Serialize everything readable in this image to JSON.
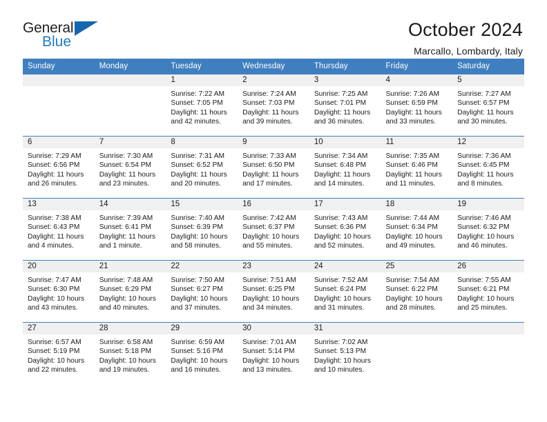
{
  "brand": {
    "name_top": "General",
    "name_bottom": "Blue",
    "triangle_color": "#1566ae",
    "blue_color": "#1f7ac4"
  },
  "header": {
    "title": "October 2024",
    "subtitle": "Marcallo, Lombardy, Italy"
  },
  "theme": {
    "header_bg": "#3f7fbf",
    "daynum_bg": "#f0f0f0",
    "text": "#1a1a1a"
  },
  "weekdays": [
    "Sunday",
    "Monday",
    "Tuesday",
    "Wednesday",
    "Thursday",
    "Friday",
    "Saturday"
  ],
  "labels": {
    "sunrise_prefix": "Sunrise:",
    "sunset_prefix": "Sunset:",
    "daylight_prefix": "Daylight:"
  },
  "weeks": [
    [
      {
        "blank": true
      },
      {
        "blank": true
      },
      {
        "day": "1",
        "sunrise": "Sunrise: 7:22 AM",
        "sunset": "Sunset: 7:05 PM",
        "daylight_line1": "Daylight: 11 hours",
        "daylight_line2": "and 42 minutes."
      },
      {
        "day": "2",
        "sunrise": "Sunrise: 7:24 AM",
        "sunset": "Sunset: 7:03 PM",
        "daylight_line1": "Daylight: 11 hours",
        "daylight_line2": "and 39 minutes."
      },
      {
        "day": "3",
        "sunrise": "Sunrise: 7:25 AM",
        "sunset": "Sunset: 7:01 PM",
        "daylight_line1": "Daylight: 11 hours",
        "daylight_line2": "and 36 minutes."
      },
      {
        "day": "4",
        "sunrise": "Sunrise: 7:26 AM",
        "sunset": "Sunset: 6:59 PM",
        "daylight_line1": "Daylight: 11 hours",
        "daylight_line2": "and 33 minutes."
      },
      {
        "day": "5",
        "sunrise": "Sunrise: 7:27 AM",
        "sunset": "Sunset: 6:57 PM",
        "daylight_line1": "Daylight: 11 hours",
        "daylight_line2": "and 30 minutes."
      }
    ],
    [
      {
        "day": "6",
        "sunrise": "Sunrise: 7:29 AM",
        "sunset": "Sunset: 6:56 PM",
        "daylight_line1": "Daylight: 11 hours",
        "daylight_line2": "and 26 minutes."
      },
      {
        "day": "7",
        "sunrise": "Sunrise: 7:30 AM",
        "sunset": "Sunset: 6:54 PM",
        "daylight_line1": "Daylight: 11 hours",
        "daylight_line2": "and 23 minutes."
      },
      {
        "day": "8",
        "sunrise": "Sunrise: 7:31 AM",
        "sunset": "Sunset: 6:52 PM",
        "daylight_line1": "Daylight: 11 hours",
        "daylight_line2": "and 20 minutes."
      },
      {
        "day": "9",
        "sunrise": "Sunrise: 7:33 AM",
        "sunset": "Sunset: 6:50 PM",
        "daylight_line1": "Daylight: 11 hours",
        "daylight_line2": "and 17 minutes."
      },
      {
        "day": "10",
        "sunrise": "Sunrise: 7:34 AM",
        "sunset": "Sunset: 6:48 PM",
        "daylight_line1": "Daylight: 11 hours",
        "daylight_line2": "and 14 minutes."
      },
      {
        "day": "11",
        "sunrise": "Sunrise: 7:35 AM",
        "sunset": "Sunset: 6:46 PM",
        "daylight_line1": "Daylight: 11 hours",
        "daylight_line2": "and 11 minutes."
      },
      {
        "day": "12",
        "sunrise": "Sunrise: 7:36 AM",
        "sunset": "Sunset: 6:45 PM",
        "daylight_line1": "Daylight: 11 hours",
        "daylight_line2": "and 8 minutes."
      }
    ],
    [
      {
        "day": "13",
        "sunrise": "Sunrise: 7:38 AM",
        "sunset": "Sunset: 6:43 PM",
        "daylight_line1": "Daylight: 11 hours",
        "daylight_line2": "and 4 minutes."
      },
      {
        "day": "14",
        "sunrise": "Sunrise: 7:39 AM",
        "sunset": "Sunset: 6:41 PM",
        "daylight_line1": "Daylight: 11 hours",
        "daylight_line2": "and 1 minute."
      },
      {
        "day": "15",
        "sunrise": "Sunrise: 7:40 AM",
        "sunset": "Sunset: 6:39 PM",
        "daylight_line1": "Daylight: 10 hours",
        "daylight_line2": "and 58 minutes."
      },
      {
        "day": "16",
        "sunrise": "Sunrise: 7:42 AM",
        "sunset": "Sunset: 6:37 PM",
        "daylight_line1": "Daylight: 10 hours",
        "daylight_line2": "and 55 minutes."
      },
      {
        "day": "17",
        "sunrise": "Sunrise: 7:43 AM",
        "sunset": "Sunset: 6:36 PM",
        "daylight_line1": "Daylight: 10 hours",
        "daylight_line2": "and 52 minutes."
      },
      {
        "day": "18",
        "sunrise": "Sunrise: 7:44 AM",
        "sunset": "Sunset: 6:34 PM",
        "daylight_line1": "Daylight: 10 hours",
        "daylight_line2": "and 49 minutes."
      },
      {
        "day": "19",
        "sunrise": "Sunrise: 7:46 AM",
        "sunset": "Sunset: 6:32 PM",
        "daylight_line1": "Daylight: 10 hours",
        "daylight_line2": "and 46 minutes."
      }
    ],
    [
      {
        "day": "20",
        "sunrise": "Sunrise: 7:47 AM",
        "sunset": "Sunset: 6:30 PM",
        "daylight_line1": "Daylight: 10 hours",
        "daylight_line2": "and 43 minutes."
      },
      {
        "day": "21",
        "sunrise": "Sunrise: 7:48 AM",
        "sunset": "Sunset: 6:29 PM",
        "daylight_line1": "Daylight: 10 hours",
        "daylight_line2": "and 40 minutes."
      },
      {
        "day": "22",
        "sunrise": "Sunrise: 7:50 AM",
        "sunset": "Sunset: 6:27 PM",
        "daylight_line1": "Daylight: 10 hours",
        "daylight_line2": "and 37 minutes."
      },
      {
        "day": "23",
        "sunrise": "Sunrise: 7:51 AM",
        "sunset": "Sunset: 6:25 PM",
        "daylight_line1": "Daylight: 10 hours",
        "daylight_line2": "and 34 minutes."
      },
      {
        "day": "24",
        "sunrise": "Sunrise: 7:52 AM",
        "sunset": "Sunset: 6:24 PM",
        "daylight_line1": "Daylight: 10 hours",
        "daylight_line2": "and 31 minutes."
      },
      {
        "day": "25",
        "sunrise": "Sunrise: 7:54 AM",
        "sunset": "Sunset: 6:22 PM",
        "daylight_line1": "Daylight: 10 hours",
        "daylight_line2": "and 28 minutes."
      },
      {
        "day": "26",
        "sunrise": "Sunrise: 7:55 AM",
        "sunset": "Sunset: 6:21 PM",
        "daylight_line1": "Daylight: 10 hours",
        "daylight_line2": "and 25 minutes."
      }
    ],
    [
      {
        "day": "27",
        "sunrise": "Sunrise: 6:57 AM",
        "sunset": "Sunset: 5:19 PM",
        "daylight_line1": "Daylight: 10 hours",
        "daylight_line2": "and 22 minutes."
      },
      {
        "day": "28",
        "sunrise": "Sunrise: 6:58 AM",
        "sunset": "Sunset: 5:18 PM",
        "daylight_line1": "Daylight: 10 hours",
        "daylight_line2": "and 19 minutes."
      },
      {
        "day": "29",
        "sunrise": "Sunrise: 6:59 AM",
        "sunset": "Sunset: 5:16 PM",
        "daylight_line1": "Daylight: 10 hours",
        "daylight_line2": "and 16 minutes."
      },
      {
        "day": "30",
        "sunrise": "Sunrise: 7:01 AM",
        "sunset": "Sunset: 5:14 PM",
        "daylight_line1": "Daylight: 10 hours",
        "daylight_line2": "and 13 minutes."
      },
      {
        "day": "31",
        "sunrise": "Sunrise: 7:02 AM",
        "sunset": "Sunset: 5:13 PM",
        "daylight_line1": "Daylight: 10 hours",
        "daylight_line2": "and 10 minutes."
      },
      {
        "blank": true
      },
      {
        "blank": true
      }
    ]
  ]
}
